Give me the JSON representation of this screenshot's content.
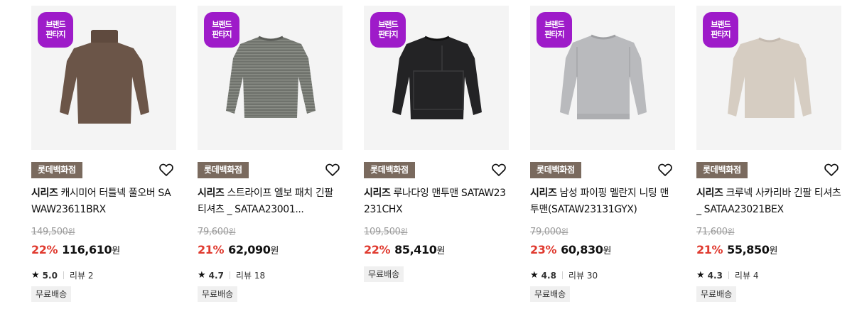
{
  "products": [
    {
      "badge_line1": "브랜드",
      "badge_line2": "판타지",
      "store": "롯데백화점",
      "brand": "시리즈",
      "name": "캐시미어 터틀넥 풀오버 SAWAW23611BRX",
      "original_price": "149,500",
      "discount": "22%",
      "sale_price": "116,610",
      "rating": "5.0",
      "reviews": "리뷰 2",
      "shipping": "무료배송",
      "garment_color": "#6b5548",
      "garment_style": "turtleneck"
    },
    {
      "badge_line1": "브랜드",
      "badge_line2": "판타지",
      "store": "롯데백화점",
      "brand": "시리즈",
      "name": "스트라이프 엘보 패치 긴팔 티셔츠 _ SATAA23001...",
      "original_price": "79,600",
      "discount": "21%",
      "sale_price": "62,090",
      "rating": "4.7",
      "reviews": "리뷰 18",
      "shipping": "무료배송",
      "garment_color": "#6f726c",
      "garment_style": "crew"
    },
    {
      "badge_line1": "브랜드",
      "badge_line2": "판타지",
      "store": "롯데백화점",
      "brand": "시리즈",
      "name": "루나다잉 맨투맨 SATAW23231CHX",
      "original_price": "109,500",
      "discount": "22%",
      "sale_price": "85,410",
      "rating": "",
      "reviews": "",
      "shipping": "무료배송",
      "garment_color": "#232325",
      "garment_style": "crew"
    },
    {
      "badge_line1": "브랜드",
      "badge_line2": "판타지",
      "store": "롯데백화점",
      "brand": "시리즈",
      "name": "남성 파이핑 멜란지 니팅 맨투맨(SATAW23131GYX)",
      "original_price": "79,000",
      "discount": "23%",
      "sale_price": "60,830",
      "rating": "4.8",
      "reviews": "리뷰 30",
      "shipping": "무료배송",
      "garment_color": "#b9babd",
      "garment_style": "crew"
    },
    {
      "badge_line1": "브랜드",
      "badge_line2": "판타지",
      "store": "롯데백화점",
      "brand": "시리즈",
      "name": "크루넥 사카리바 긴팔 티셔츠 _ SATAA23021BEX",
      "original_price": "71,600",
      "discount": "21%",
      "sale_price": "55,850",
      "rating": "4.3",
      "reviews": "리뷰 4",
      "shipping": "무료배송",
      "garment_color": "#d6cdc2",
      "garment_style": "crew"
    }
  ],
  "currency_unit": "원",
  "colors": {
    "badge": "#9e1bc9",
    "store_tag": "#7a6a5e",
    "discount": "#e03a2f"
  }
}
